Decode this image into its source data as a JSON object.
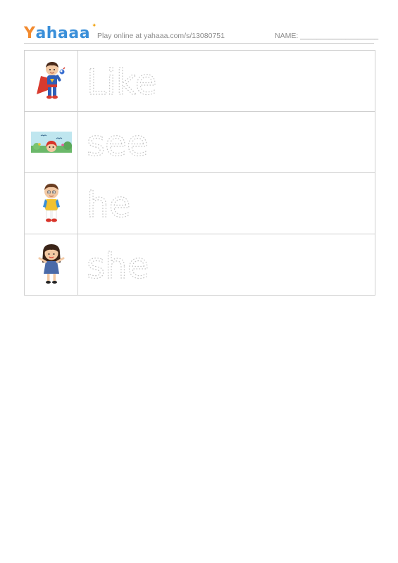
{
  "header": {
    "logo_letters": [
      "Y",
      "a",
      "h",
      "a",
      "a",
      "a"
    ],
    "logo_colors": [
      "#f28b30",
      "#3a8fd9",
      "#3a8fd9",
      "#3a8fd9",
      "#3a8fd9",
      "#3a8fd9"
    ],
    "play_text": "Play online at yahaaa.com/s/13080751",
    "name_label": "NAME: ___________________"
  },
  "rows": [
    {
      "word": "Like",
      "picture": "superhero-boy-icon"
    },
    {
      "word": "see",
      "picture": "girl-peeking-landscape-icon"
    },
    {
      "word": "he",
      "picture": "boy-icon"
    },
    {
      "word": "she",
      "picture": "girl-icon"
    }
  ],
  "colors": {
    "grid_line": "#cfcfcf",
    "trace_stroke": "#c4c4c4",
    "header_text": "#8a8a8a"
  }
}
